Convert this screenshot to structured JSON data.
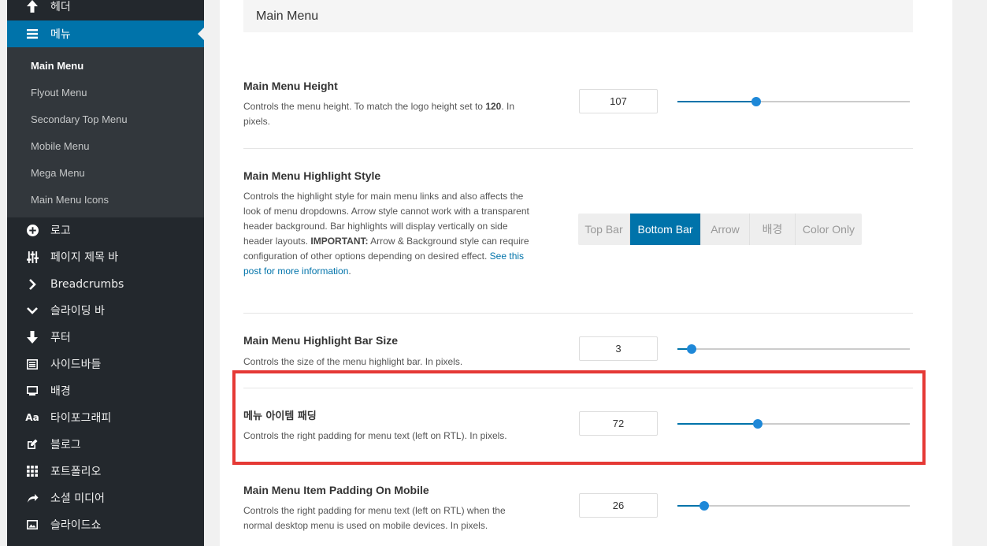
{
  "sidebar": {
    "items": [
      {
        "label": "헤더",
        "icon": "arrow-up-icon"
      },
      {
        "label": "메뉴",
        "icon": "menu-icon"
      },
      {
        "label": "로고",
        "icon": "plus-circle-icon"
      },
      {
        "label": "페이지 제목 바",
        "icon": "sliders-icon"
      },
      {
        "label": "Breadcrumbs",
        "icon": "chevron-right-icon"
      },
      {
        "label": "슬라이딩 바",
        "icon": "chevron-down-icon"
      },
      {
        "label": "푸터",
        "icon": "arrow-down-icon"
      },
      {
        "label": "사이드바들",
        "icon": "sidebar-layout-icon"
      },
      {
        "label": "배경",
        "icon": "monitor-icon"
      },
      {
        "label": "타이포그래피",
        "icon": "typography-icon"
      },
      {
        "label": "블로그",
        "icon": "edit-icon"
      },
      {
        "label": "포트폴리오",
        "icon": "grid-icon"
      },
      {
        "label": "소셜 미디어",
        "icon": "share-icon"
      },
      {
        "label": "슬라이드쇼",
        "icon": "image-icon"
      }
    ],
    "submenu": [
      "Main Menu",
      "Flyout Menu",
      "Secondary Top Menu",
      "Mobile Menu",
      "Mega Menu",
      "Main Menu Icons"
    ]
  },
  "main": {
    "section_title": "Main Menu",
    "height": {
      "title": "Main Menu Height",
      "desc_pre": "Controls the menu height. To match the logo height set to ",
      "desc_bold": "120",
      "desc_post": ". In pixels.",
      "value": "107",
      "slider_fraction": 0.34
    },
    "highlight_style": {
      "title": "Main Menu Highlight Style",
      "desc_pre": "Controls the highlight style for main menu links and also affects the look of menu dropdowns. Arrow style cannot work with a transparent header background. Bar highlights will display vertically on side header layouts. ",
      "desc_bold": "IMPORTANT:",
      "desc_mid": " Arrow & Background style can require configuration of other options depending on desired effect. ",
      "desc_link": "See this post for more information",
      "desc_post": ".",
      "options": [
        "Top Bar",
        "Bottom Bar",
        "Arrow",
        "배경",
        "Color Only"
      ],
      "selected": "Bottom Bar"
    },
    "bar_size": {
      "title": "Main Menu Highlight Bar Size",
      "desc": "Controls the size of the menu highlight bar. In pixels.",
      "value": "3",
      "slider_fraction": 0.06
    },
    "item_padding": {
      "title": "메뉴 아이템 패딩",
      "desc": "Controls the right padding for menu text (left on RTL). In pixels.",
      "value": "72",
      "slider_fraction": 0.345
    },
    "item_padding_mobile": {
      "title": "Main Menu Item Padding On Mobile",
      "desc": "Controls the right padding for menu text (left on RTL) when the normal desktop menu is used on mobile devices. In pixels.",
      "value": "26",
      "slider_fraction": 0.115
    }
  },
  "colors": {
    "accent": "#0073aa",
    "sidebar_bg": "#23282d",
    "highlight_border": "#e53935"
  }
}
